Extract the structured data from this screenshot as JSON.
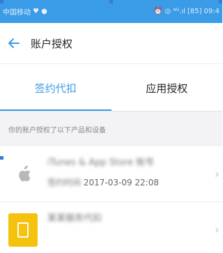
{
  "status_bar": {
    "carrier": "中国移动",
    "left_icons": "♥ ●",
    "right_icons": "⏰ ◎ ⁴ᴳ.ıl",
    "battery": "[85]",
    "time": "09:4"
  },
  "header": {
    "back_icon": "arrow-left",
    "title": "账户授权"
  },
  "tabs": [
    {
      "label": "签约代扣",
      "active": true
    },
    {
      "label": "应用授权",
      "active": false
    }
  ],
  "section_header": "你的账户授权了以下产品和设备",
  "items": [
    {
      "icon": "apple-logo",
      "title": "iTunes & App Store 账号",
      "subtitle_prefix": "签约时间",
      "subtitle_value": "2017-03-09 22:08"
    },
    {
      "icon": "app-logo",
      "title": "某某服务代扣",
      "subtitle_prefix": "",
      "subtitle_value": ""
    }
  ],
  "colors": {
    "accent": "#3a9be6",
    "section_bg": "#f3f3f5",
    "app_icon": "#f5c20e"
  }
}
